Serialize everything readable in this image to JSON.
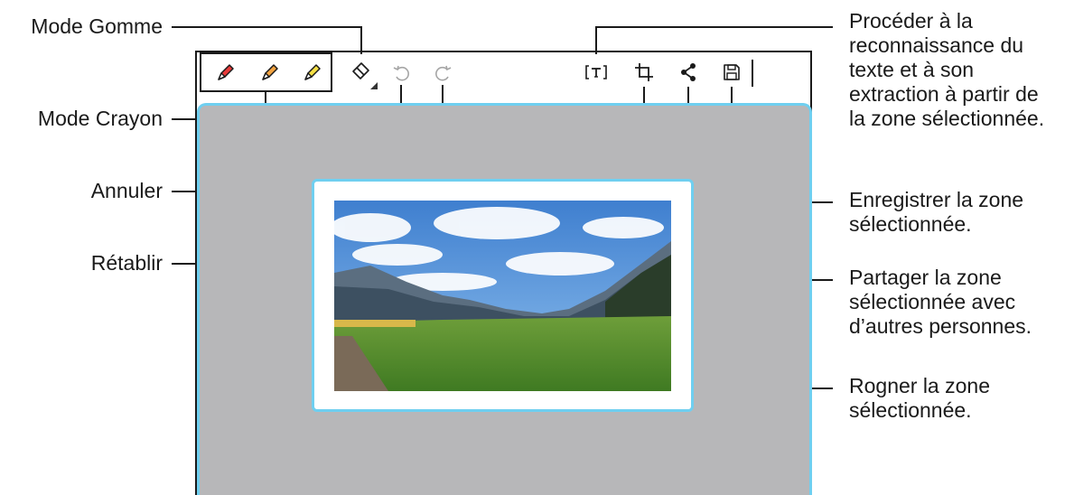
{
  "labels": {
    "eraser_mode": "Mode Gomme",
    "pen_mode": "Mode Crayon",
    "undo": "Annuler",
    "redo": "Rétablir",
    "text_recognition": [
      "Procéder à la",
      "reconnaissance du",
      "texte et à son",
      "extraction à partir de",
      "la zone sélectionnée."
    ],
    "save": [
      "Enregistrer la zone",
      "sélectionnée."
    ],
    "share": [
      "Partager la zone",
      "sélectionnée avec",
      "d’autres personnes."
    ],
    "crop": [
      "Rogner la zone",
      "sélectionnée."
    ]
  },
  "toolbar": {
    "pens": [
      {
        "icon": "red-pen-icon",
        "color": "#e83a3a"
      },
      {
        "icon": "orange-pen-icon",
        "color": "#f2a341"
      },
      {
        "icon": "yellow-pen-icon",
        "color": "#f6e045"
      }
    ],
    "icons": [
      "eraser-icon",
      "undo-icon",
      "redo-icon",
      "text-extract-icon",
      "crop-icon",
      "share-icon",
      "save-icon"
    ]
  },
  "colors": {
    "selection_border": "#6fcff0",
    "capture_background": "#b7b7b9",
    "callout_line": "#1a1a1a"
  }
}
